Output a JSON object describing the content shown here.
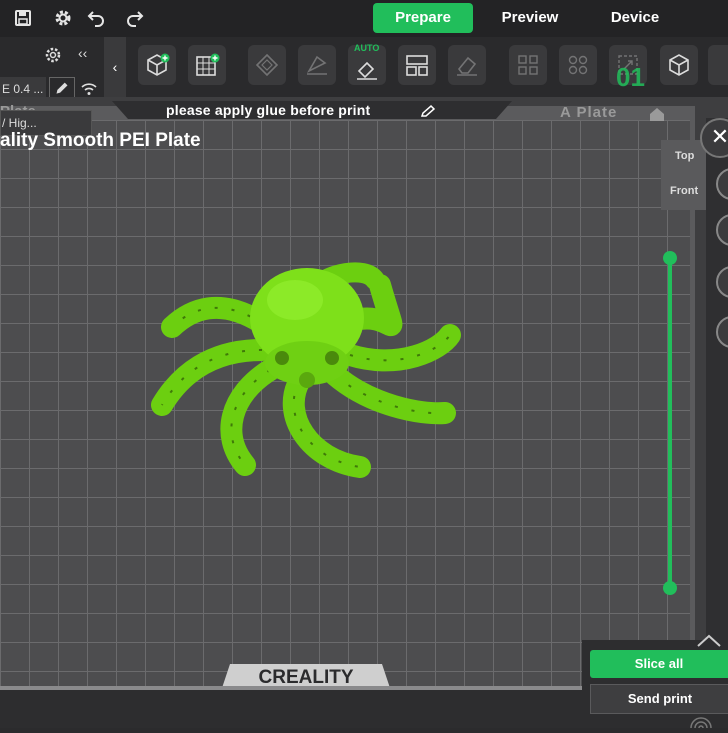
{
  "tabs": [
    {
      "label": "Prepare",
      "active": true
    },
    {
      "label": "Preview",
      "active": false
    },
    {
      "label": "Device",
      "active": false
    }
  ],
  "sidepanel": {
    "nozzle_text": "E 0.4 ...",
    "profile_text": "/ Hig..."
  },
  "toolbar": {
    "auto_label": "AUTO",
    "counter": "01"
  },
  "plate": {
    "glue_notice": "please apply glue before print",
    "left_label": "Plate",
    "right_label": "A Plate",
    "bed_name": "ality Smooth PEI Plate"
  },
  "camera": {
    "top_label": "Top",
    "front_label": "Front"
  },
  "brand": "CREALITY",
  "actions": {
    "slice_all": "Slice all",
    "send_print": "Send print"
  },
  "colors": {
    "accent": "#21be5b",
    "model": "#7ee01a"
  }
}
